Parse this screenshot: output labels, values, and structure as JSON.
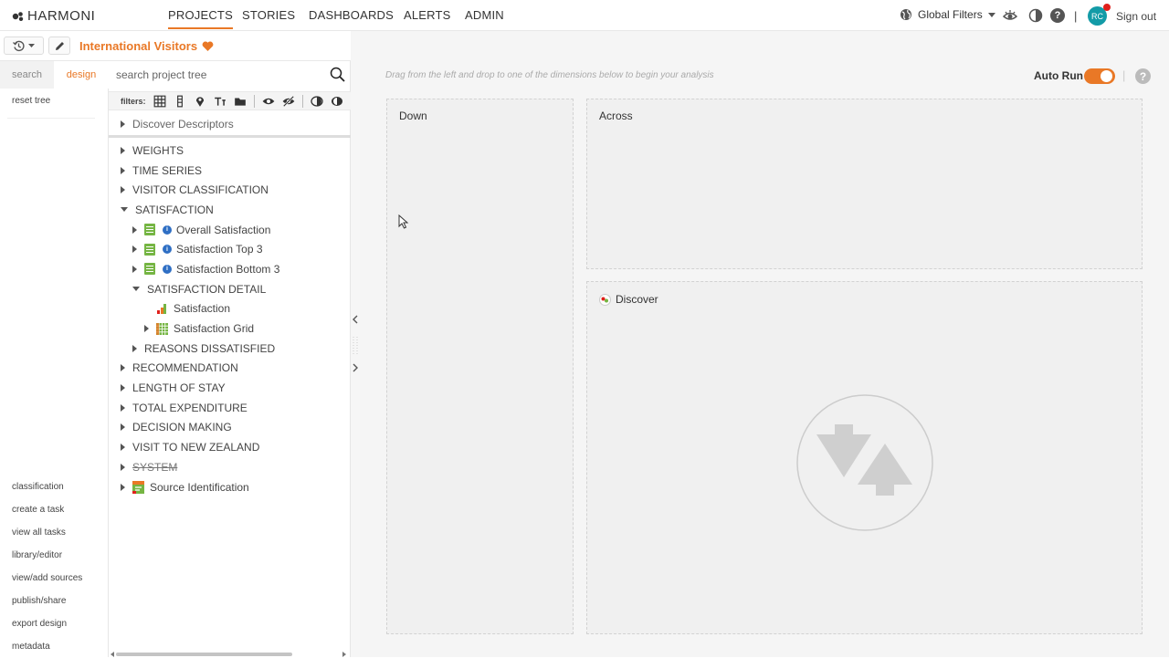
{
  "brand": "HARMONI",
  "nav": {
    "items": [
      "PROJECTS",
      "STORIES",
      "DASHBOARDS",
      "ALERTS",
      "ADMIN"
    ],
    "active": "PROJECTS"
  },
  "topright": {
    "global_filters": "Global Filters",
    "avatar_initials": "RC",
    "separator": "|",
    "sign_out": "Sign out",
    "help": "?"
  },
  "project": {
    "title": "International Visitors"
  },
  "leftpanel": {
    "tabs": [
      "search",
      "design"
    ],
    "active_tab": "design",
    "reset_tree": "reset tree",
    "links": [
      "classification",
      "create a task",
      "view all tasks",
      "library/editor",
      "view/add sources",
      "publish/share",
      "export design",
      "metadata"
    ]
  },
  "tree": {
    "search_placeholder": "search project tree",
    "filters_label": "filters:",
    "discover_descriptors": "Discover Descriptors",
    "items": [
      {
        "label": "WEIGHTS",
        "level": 0,
        "state": "collapsed",
        "icon": "none"
      },
      {
        "label": "TIME SERIES",
        "level": 0,
        "state": "collapsed",
        "icon": "none"
      },
      {
        "label": "VISITOR CLASSIFICATION",
        "level": 0,
        "state": "collapsed",
        "icon": "none"
      },
      {
        "label": "SATISFACTION",
        "level": 0,
        "state": "expanded",
        "icon": "none"
      },
      {
        "label": "Overall Satisfaction",
        "level": 1,
        "state": "collapsed",
        "icon": "doc-info"
      },
      {
        "label": "Satisfaction Top 3",
        "level": 1,
        "state": "collapsed",
        "icon": "doc-info"
      },
      {
        "label": "Satisfaction Bottom 3",
        "level": 1,
        "state": "collapsed",
        "icon": "doc-info"
      },
      {
        "label": "SATISFACTION DETAIL",
        "level": 1,
        "state": "expanded",
        "icon": "none"
      },
      {
        "label": "Satisfaction",
        "level": 2,
        "state": "leaf",
        "icon": "bar-chart"
      },
      {
        "label": "Satisfaction Grid",
        "level": 2,
        "state": "collapsed",
        "icon": "grid"
      },
      {
        "label": "REASONS DISSATISFIED",
        "level": 1,
        "state": "collapsed",
        "icon": "none"
      },
      {
        "label": "RECOMMENDATION",
        "level": 0,
        "state": "collapsed",
        "icon": "none"
      },
      {
        "label": "LENGTH OF STAY",
        "level": 0,
        "state": "collapsed",
        "icon": "none"
      },
      {
        "label": "TOTAL EXPENDITURE",
        "level": 0,
        "state": "collapsed",
        "icon": "none"
      },
      {
        "label": "DECISION MAKING",
        "level": 0,
        "state": "collapsed",
        "icon": "none"
      },
      {
        "label": "VISIT TO NEW ZEALAND",
        "level": 0,
        "state": "collapsed",
        "icon": "none"
      },
      {
        "label": "SYSTEM",
        "level": 0,
        "state": "collapsed",
        "icon": "strikethrough"
      },
      {
        "label": "Source Identification",
        "level": 0,
        "state": "collapsed",
        "icon": "source"
      }
    ]
  },
  "main": {
    "hint": "Drag from the left and drop to one of the dimensions below to begin your analysis",
    "auto_run_label": "Auto Run",
    "auto_run_on": true,
    "help": "?",
    "zones": {
      "down": "Down",
      "across": "Across",
      "discover": "Discover"
    }
  },
  "colors": {
    "accent": "#e97826",
    "avatar": "#139ba7",
    "notification": "#e0201b",
    "info": "#2f6fc4",
    "doc": "#75b543"
  }
}
